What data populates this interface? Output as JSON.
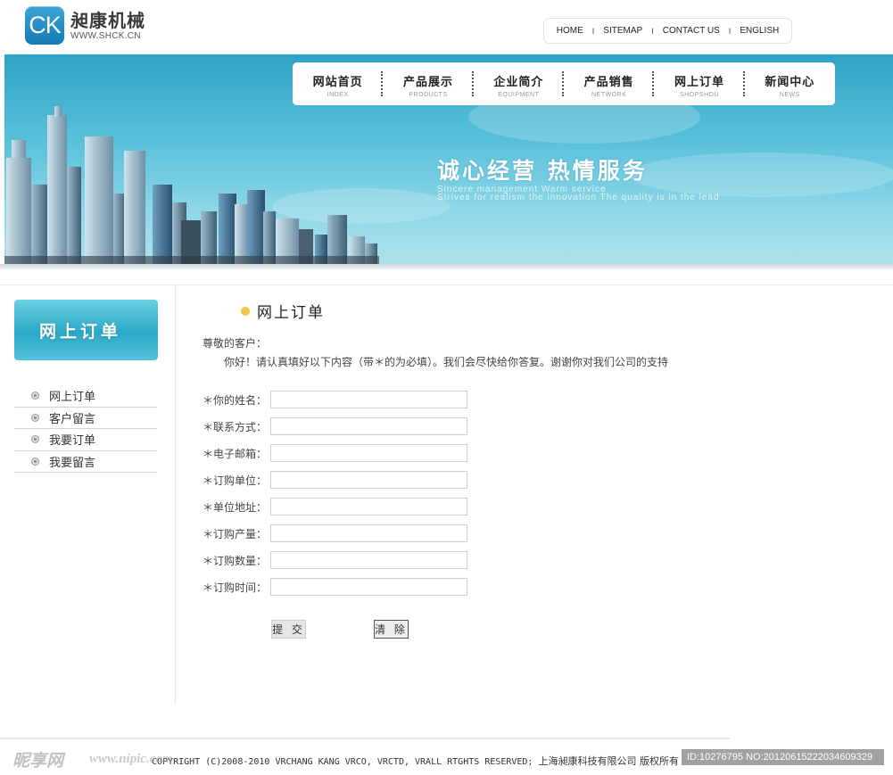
{
  "brand": {
    "logo_mark": "CK",
    "name": "昶康机械",
    "url": "WWW.SHCK.CN"
  },
  "top_nav": {
    "items": [
      "HOME",
      "SITEMAP",
      "CONTACT US",
      "ENGLISH"
    ],
    "separator": "I"
  },
  "main_nav": {
    "items": [
      {
        "cn": "网站首页",
        "en": "INDEX"
      },
      {
        "cn": "产品展示",
        "en": "PRODUCTS"
      },
      {
        "cn": "企业简介",
        "en": "EQUIPMENT"
      },
      {
        "cn": "产品销售",
        "en": "NETWORK"
      },
      {
        "cn": "网上订单",
        "en": "SHOPSHOU"
      },
      {
        "cn": "新闻中心",
        "en": "NEWS"
      }
    ]
  },
  "banner": {
    "slogan_cn": "诚心经营  热情服务",
    "slogan_en_1": "Sincere management  Warm service",
    "slogan_en_2": "Strives for realism the innovation The quality is in the lead"
  },
  "sidebar": {
    "heading": "网上订单",
    "items": [
      "网上订单",
      "客户留言",
      "我要订单",
      "我要留言"
    ]
  },
  "content": {
    "title": "网上订单",
    "greeting": "尊敬的客户：",
    "intro": "你好！请认真填好以下内容（带＊的为必填）。我们会尽快给你答复。谢谢你对我们公司的支持"
  },
  "form": {
    "fields": [
      {
        "label": "＊你的姓名：",
        "value": "",
        "placeholder": ""
      },
      {
        "label": "＊联系方式：",
        "value": "",
        "placeholder": ""
      },
      {
        "label": "＊电子邮箱：",
        "value": "",
        "placeholder": ""
      },
      {
        "label": "＊订购单位：",
        "value": "",
        "placeholder": ""
      },
      {
        "label": "＊单位地址：",
        "value": "",
        "placeholder": ""
      },
      {
        "label": "＊订购产量：",
        "value": "",
        "placeholder": ""
      },
      {
        "label": "＊订购数量：",
        "value": "",
        "placeholder": ""
      },
      {
        "label": "＊订购时间：",
        "value": "",
        "placeholder": ""
      }
    ],
    "submit_label": "提 交",
    "reset_label": "清 除"
  },
  "footer": {
    "copyright_en": "COPYRIGHT (C)2008-2010 VRCHANG KANG  VRCO, VRCTD, VRALL RTGHTS RESERVED;",
    "copyright_cn": "上海昶康科技有限公司  版权所有"
  },
  "watermark": {
    "logo": "昵享网",
    "url": "www.nipic.com",
    "id_text": "ID:10276795 NO:20120615222034609329"
  },
  "colors": {
    "banner_top": "#2fa3c6",
    "banner_bottom": "#aee1ec",
    "sidebar_head": "#2aa8c7",
    "title_bullet": "#f4c54a"
  }
}
